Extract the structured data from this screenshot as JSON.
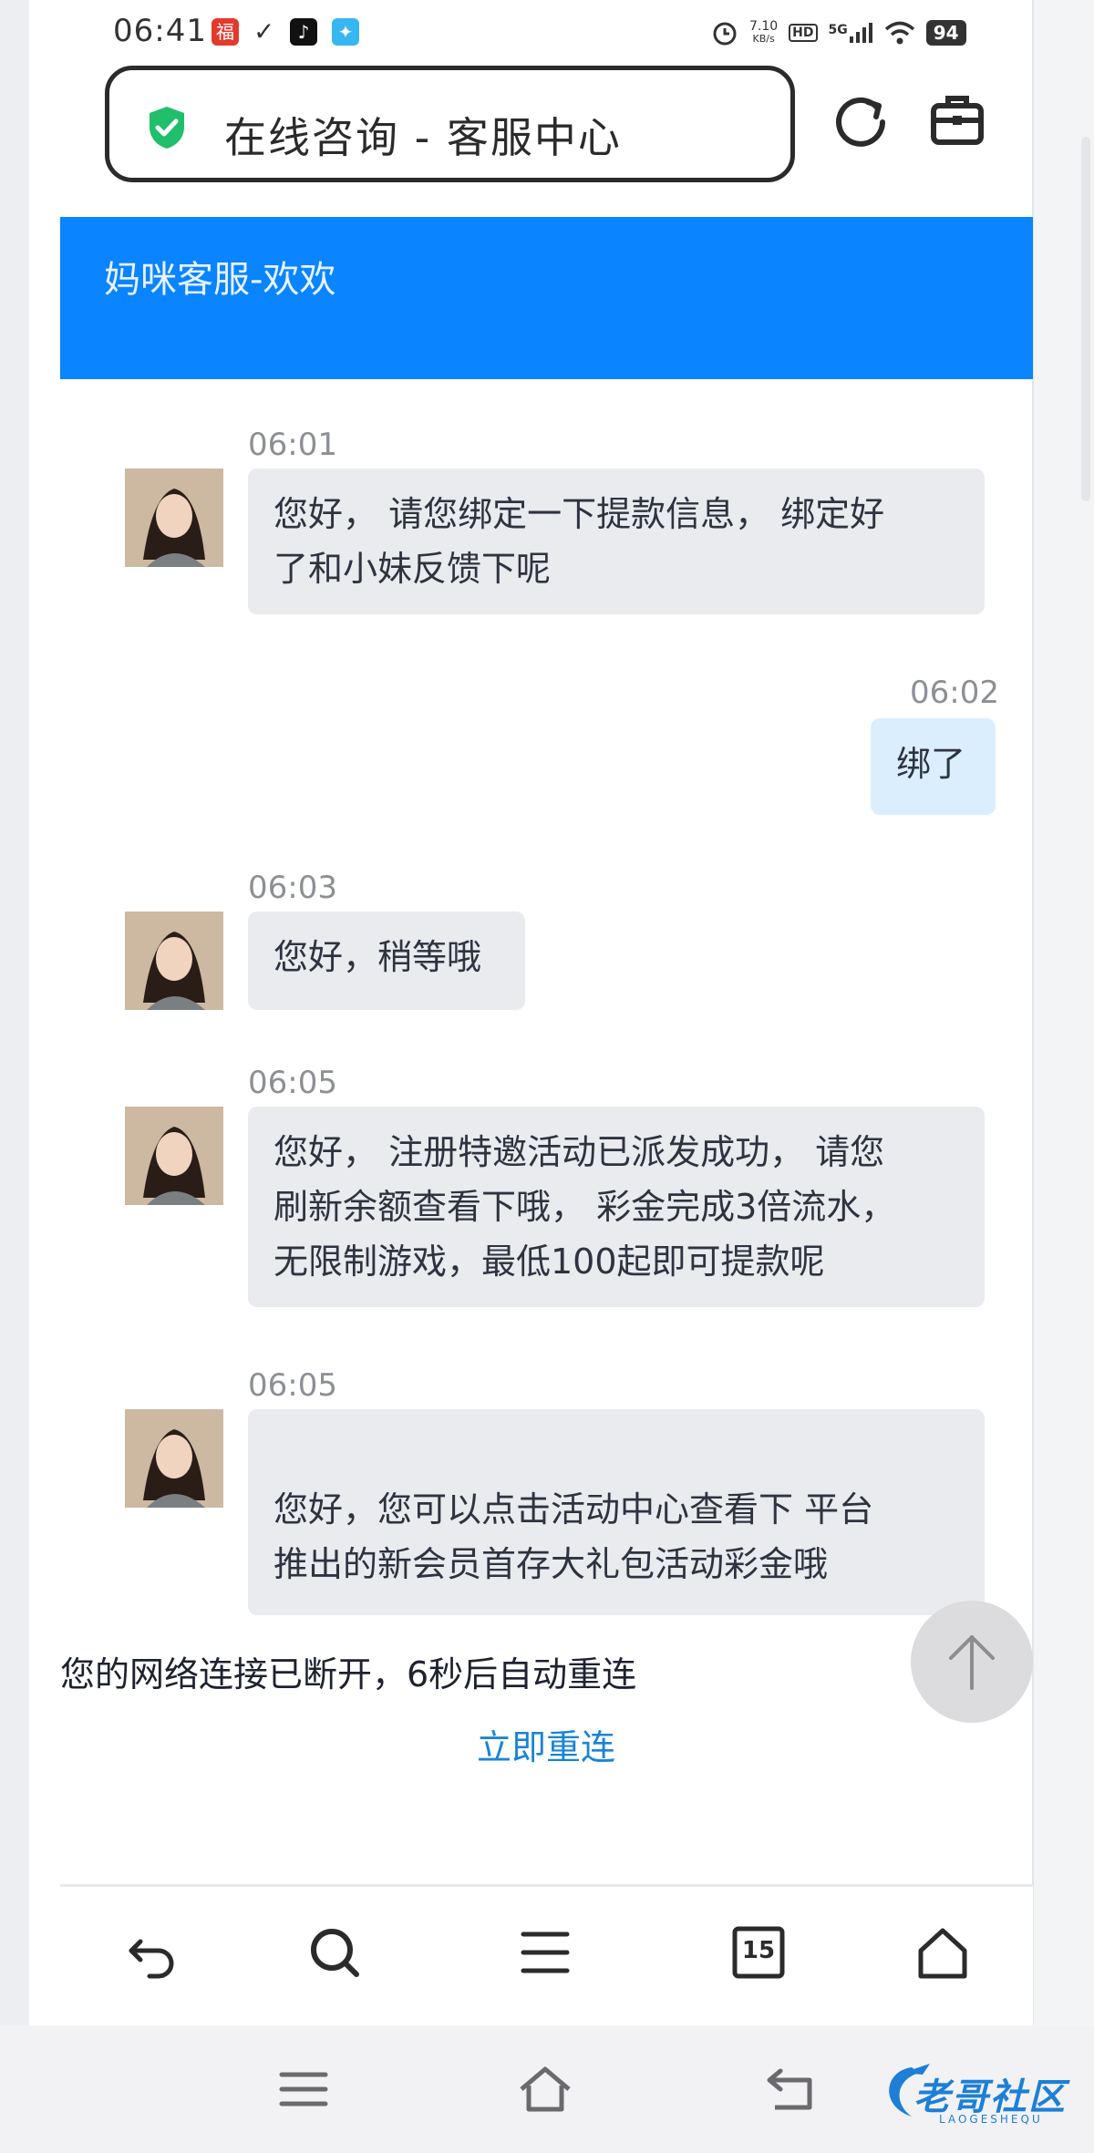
{
  "status_bar": {
    "time": "06:41",
    "net_speed_value": "7.10",
    "net_speed_unit": "KB/s",
    "hd_label": "HD",
    "network": "5G",
    "battery": "94"
  },
  "browser": {
    "url_title": "在线咨询 - 客服中心"
  },
  "chat": {
    "agent_name": "妈咪客服-欢欢",
    "messages": [
      {
        "time": "06:01",
        "from": "agent",
        "lines": [
          "您好， 请您绑定一下提款信息， 绑定好",
          "了和小妹反馈下呢"
        ]
      },
      {
        "time": "06:02",
        "from": "user",
        "lines": [
          "绑了"
        ]
      },
      {
        "time": "06:03",
        "from": "agent",
        "lines": [
          "您好，稍等哦"
        ]
      },
      {
        "time": "06:05",
        "from": "agent",
        "lines": [
          "您好， 注册特邀活动已派发成功， 请您",
          "刷新余额查看下哦， 彩金完成3倍流水，",
          "无限制游戏，最低100起即可提款呢"
        ]
      },
      {
        "time": "06:05",
        "from": "agent",
        "lines": [
          "",
          "您好，您可以点击活动中心查看下 平台",
          "推出的新会员首存大礼包活动彩金哦"
        ]
      }
    ],
    "network_notice": "您的网络连接已断开，6秒后自动重连",
    "reconnect_label": "立即重连"
  },
  "bottom_toolbar": {
    "calendar_day": "15"
  },
  "watermark": {
    "text": "老哥社区",
    "sub": "LAOGESHEQU"
  },
  "colors": {
    "banner": "#0a84ff",
    "agent_bubble": "#e9ebef",
    "user_bubble": "#dbeefe",
    "link": "#1a84d6",
    "shield": "#1fbf6b"
  },
  "icons": [
    "shield-check-icon",
    "refresh-icon",
    "toolbox-icon",
    "back-icon",
    "search-icon",
    "menu-icon",
    "calendar-icon",
    "home-icon",
    "arrow-up-icon",
    "alarm-icon",
    "wifi-icon",
    "signal-icon"
  ]
}
